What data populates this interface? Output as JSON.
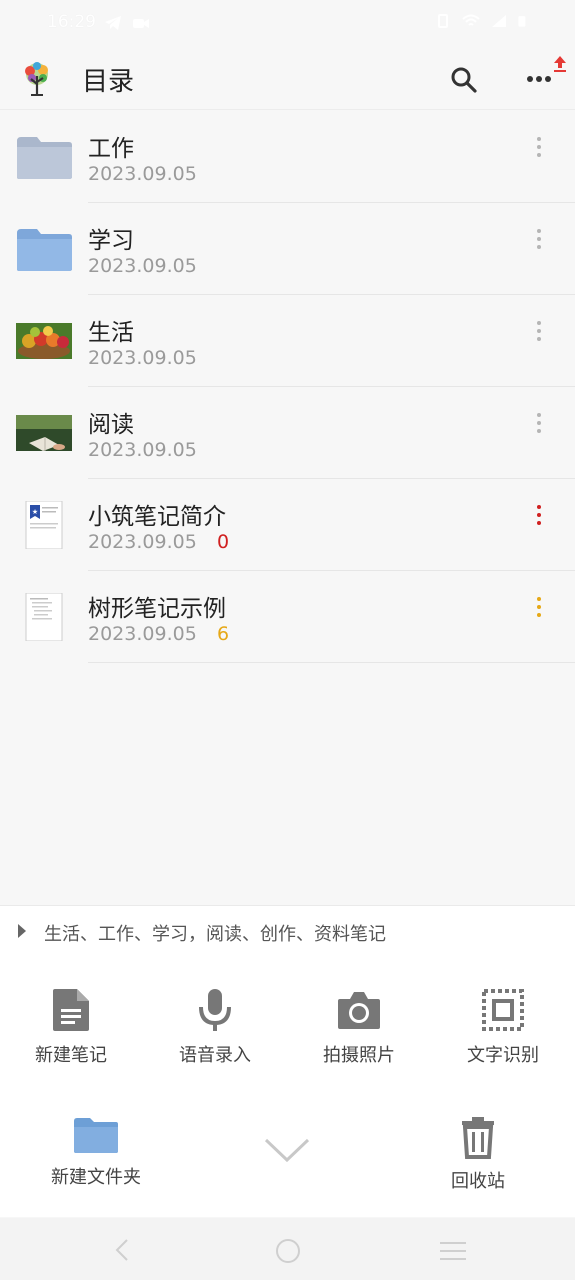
{
  "status_bar": {
    "time": "16:29"
  },
  "app_bar": {
    "title": "目录",
    "logo_icon": "tree-logo-icon",
    "search_icon": "search-icon",
    "more_icon": "more-horizontal-icon",
    "upload_icon": "upload-arrow-icon"
  },
  "items": [
    {
      "title": "工作",
      "date": "2023.09.05",
      "count": "",
      "thumb": "folder-gray-icon",
      "menu_color": "#b5b5b5"
    },
    {
      "title": "学习",
      "date": "2023.09.05",
      "count": "",
      "thumb": "folder-blue-icon",
      "menu_color": "#b5b5b5"
    },
    {
      "title": "生活",
      "date": "2023.09.05",
      "count": "",
      "thumb": "fruit-photo-thumbnail",
      "menu_color": "#b5b5b5"
    },
    {
      "title": "阅读",
      "date": "2023.09.05",
      "count": "",
      "thumb": "reading-photo-thumbnail",
      "menu_color": "#b5b5b5"
    },
    {
      "title": "小筑笔记简介",
      "date": "2023.09.05",
      "count": "0",
      "count_color": "#d02020",
      "thumb": "document-thumbnail",
      "menu_color": "#d02020"
    },
    {
      "title": "树形笔记示例",
      "date": "2023.09.05",
      "count": "6",
      "count_color": "#e6a817",
      "thumb": "document-thumbnail",
      "menu_color": "#e6a817"
    }
  ],
  "breadcrumb": {
    "text": "生活、工作、学习，阅读、创作、资料笔记"
  },
  "toolbar": {
    "new_note": "新建笔记",
    "voice_input": "语音录入",
    "take_photo": "拍摄照片",
    "text_recognition": "文字识别",
    "new_folder": "新建文件夹",
    "recycle_bin": "回收站"
  },
  "colors": {
    "accent_blue": "#7aa9dc",
    "icon_gray": "#8a8a8a",
    "folder_gray": "#b7c3d6",
    "folder_blue": "#8eb4e3"
  }
}
